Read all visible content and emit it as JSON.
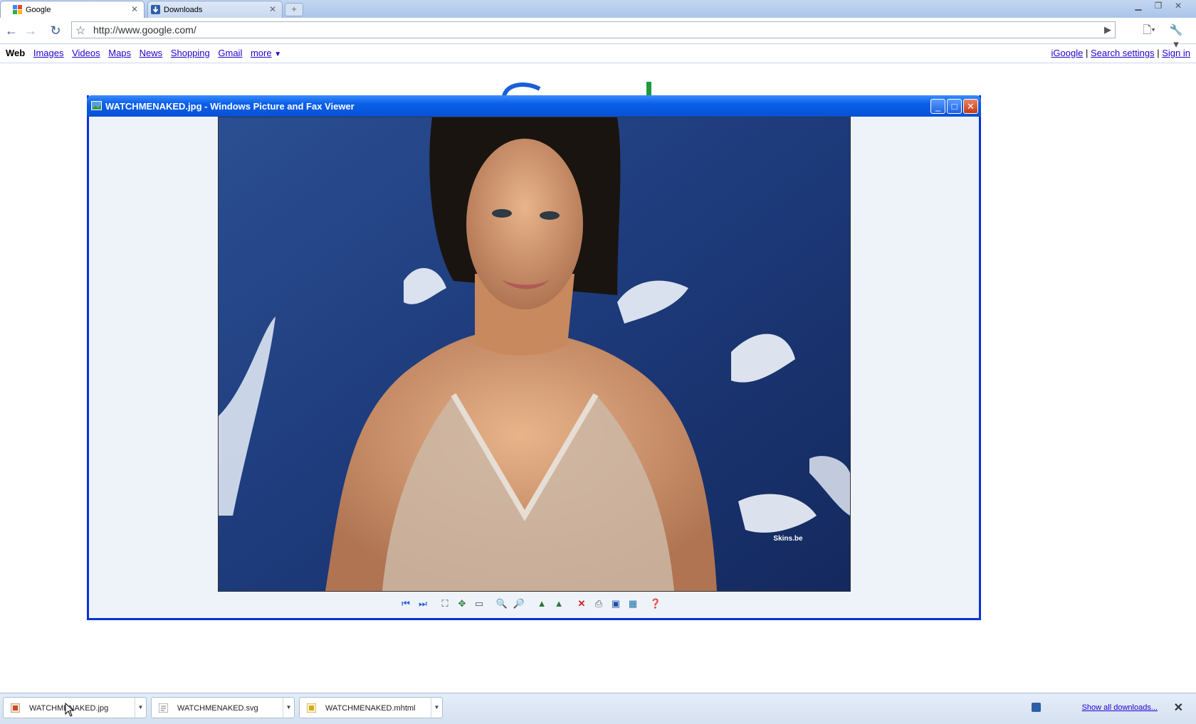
{
  "browser": {
    "tabs": [
      {
        "label": "Google",
        "active": true
      },
      {
        "label": "Downloads",
        "active": false
      }
    ],
    "address": "http://www.google.com/"
  },
  "google_bar": {
    "left_links": [
      "Web",
      "Images",
      "Videos",
      "Maps",
      "News",
      "Shopping",
      "Gmail",
      "more"
    ],
    "right_links": [
      "iGoogle",
      "Search settings",
      "Sign in"
    ],
    "separator": "|"
  },
  "viewer": {
    "title": "WATCHMENAKED.jpg - Windows Picture and Fax Viewer",
    "watermark": "Skins.be",
    "toolbar_icons": [
      "previous-image-icon",
      "next-image-icon",
      "best-fit-icon",
      "actual-size-icon",
      "slideshow-icon",
      "zoom-in-icon",
      "zoom-out-icon",
      "rotate-clockwise-icon",
      "rotate-counterclockwise-icon",
      "delete-icon",
      "print-icon",
      "save-icon",
      "edit-icon",
      "help-icon"
    ]
  },
  "downloads": {
    "items": [
      "WATCHMENAKED.jpg",
      "WATCHMENAKED.svg",
      "WATCHMENAKED.mhtml"
    ],
    "show_all": "Show all downloads..."
  },
  "colors": {
    "xp_title_blue": "#0a5fe8",
    "link_blue": "#2200cc",
    "photo_background_blue": "#1f3b78"
  }
}
